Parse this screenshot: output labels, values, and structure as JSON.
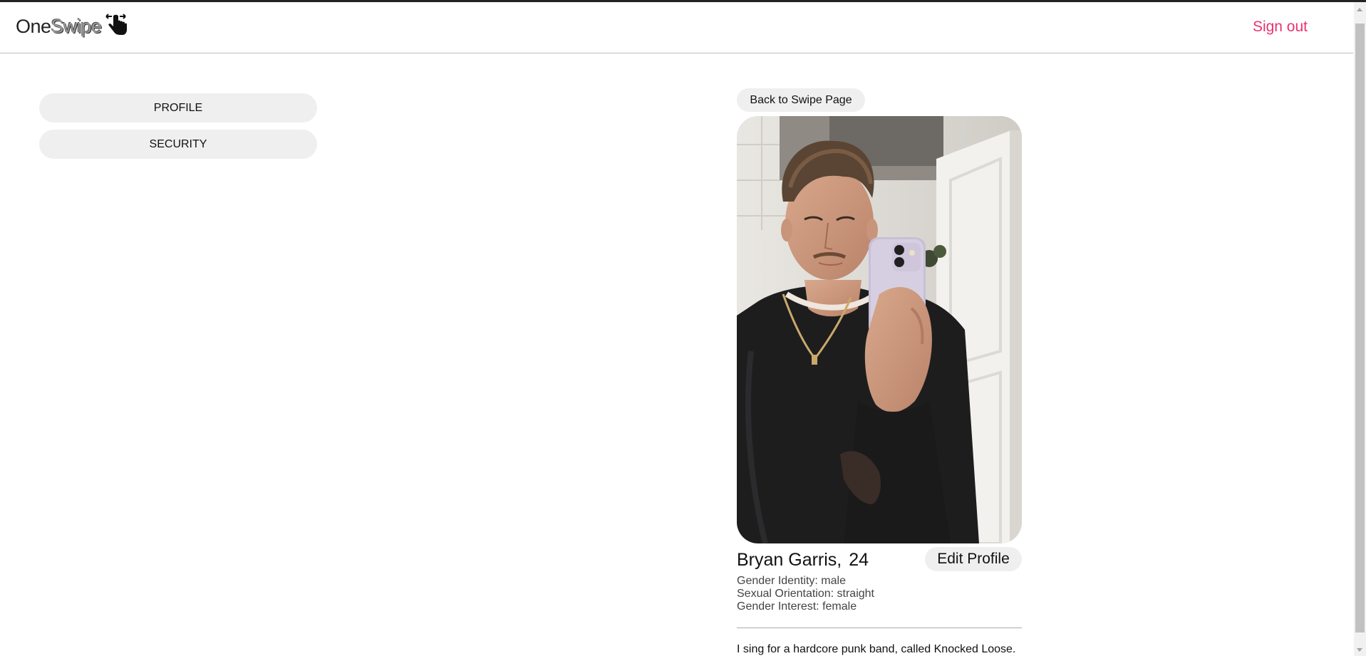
{
  "header": {
    "logo_one": "One",
    "logo_swipe": "Swipe",
    "signout_label": "Sign out"
  },
  "sidebar": {
    "items": [
      {
        "label": "PROFILE"
      },
      {
        "label": "SECURITY"
      }
    ]
  },
  "profile": {
    "back_label": "Back to Swipe Page",
    "name": "Bryan Garris,",
    "age": "24",
    "edit_label": "Edit Profile",
    "gender_identity": "Gender Identity: male",
    "sexual_orientation": "Sexual Orientation: straight",
    "gender_interest": "Gender Interest: female",
    "bio": "I sing for a hardcore punk band, called Knocked Loose."
  },
  "colors": {
    "accent": "#e8336d",
    "button_bg": "#efefef"
  }
}
